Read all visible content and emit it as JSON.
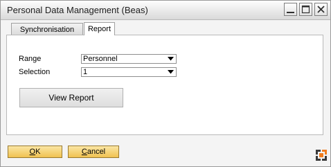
{
  "window": {
    "title": "Personal Data Management (Beas)",
    "controls": {
      "minimize": "minimize-icon",
      "maximize": "maximize-icon",
      "close": "close-icon"
    }
  },
  "tabs": [
    {
      "label": "Synchronisation",
      "active": false
    },
    {
      "label": "Report",
      "active": true
    }
  ],
  "form": {
    "range": {
      "label": "Range",
      "value": "Personnel"
    },
    "selection": {
      "label": "Selection",
      "value": "1"
    },
    "view_report_label": "View Report"
  },
  "footer": {
    "ok": {
      "mnemonic": "O",
      "rest": "K"
    },
    "cancel": {
      "mnemonic": "C",
      "rest": "ancel"
    }
  },
  "colors": {
    "accent_button": "#f0c250",
    "logo_orange": "#f07c1e",
    "logo_dark": "#3a3a3a"
  }
}
